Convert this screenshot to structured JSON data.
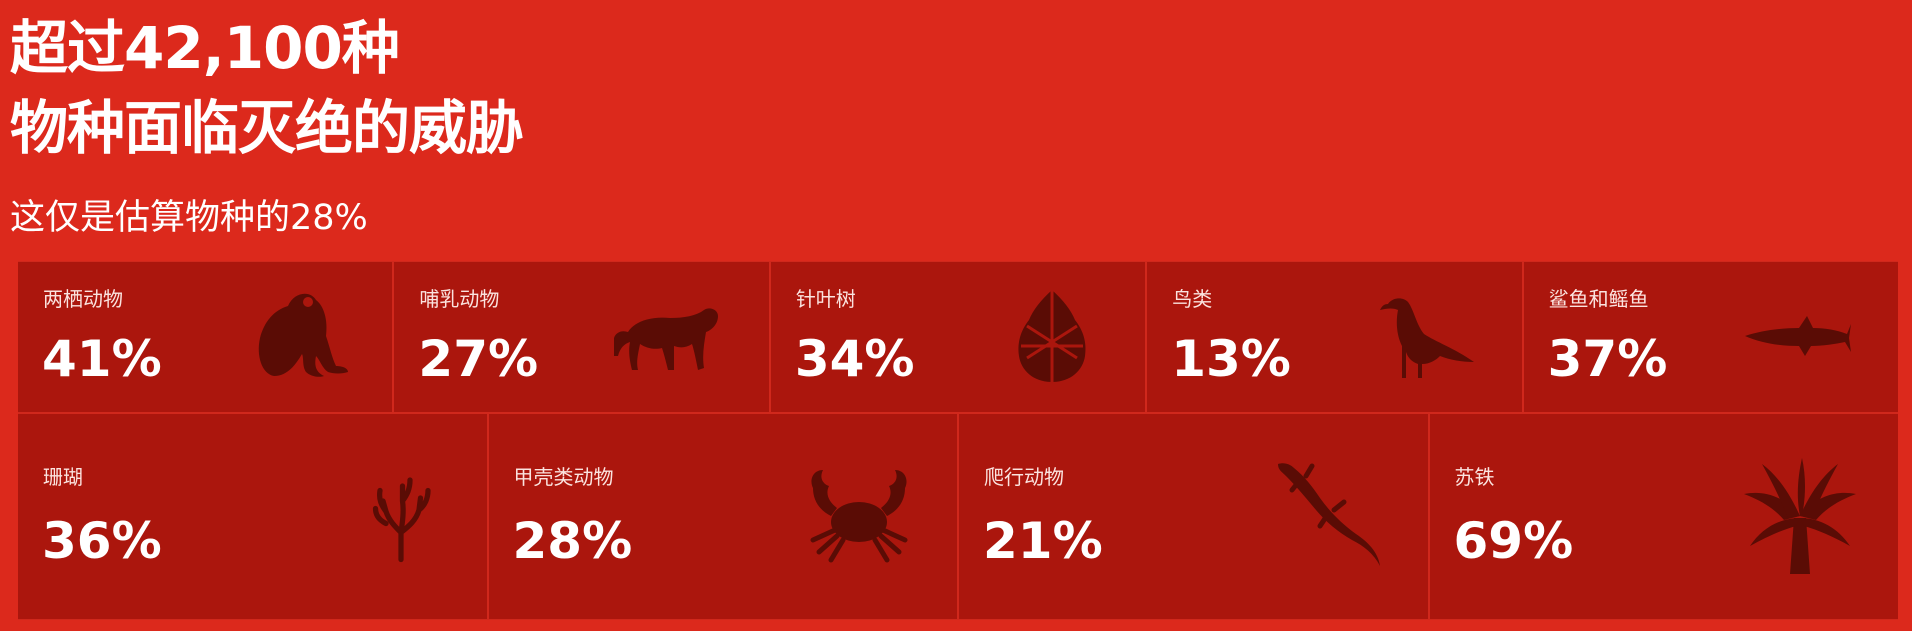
{
  "header": {
    "title_line1": "超过42,100种",
    "title_line2": "物种面临灭绝的威胁",
    "subtitle": "这仅是估算物种的28%"
  },
  "colors": {
    "background": "#dc291c",
    "tile": "#ab160d",
    "icon": "#5a0c05"
  },
  "categories": [
    {
      "label": "两栖动物",
      "percent": "41%",
      "icon": "frog-icon"
    },
    {
      "label": "哺乳动物",
      "percent": "27%",
      "icon": "tiger-icon"
    },
    {
      "label": "针叶树",
      "percent": "34%",
      "icon": "pinecone-icon"
    },
    {
      "label": "鸟类",
      "percent": "13%",
      "icon": "bird-icon"
    },
    {
      "label": "鲨鱼和鳐鱼",
      "percent": "37%",
      "icon": "shark-icon"
    },
    {
      "label": "珊瑚",
      "percent": "36%",
      "icon": "coral-icon"
    },
    {
      "label": "甲壳类动物",
      "percent": "28%",
      "icon": "crab-icon"
    },
    {
      "label": "爬行动物",
      "percent": "21%",
      "icon": "lizard-icon"
    },
    {
      "label": "苏铁",
      "percent": "69%",
      "icon": "cycad-icon"
    }
  ]
}
